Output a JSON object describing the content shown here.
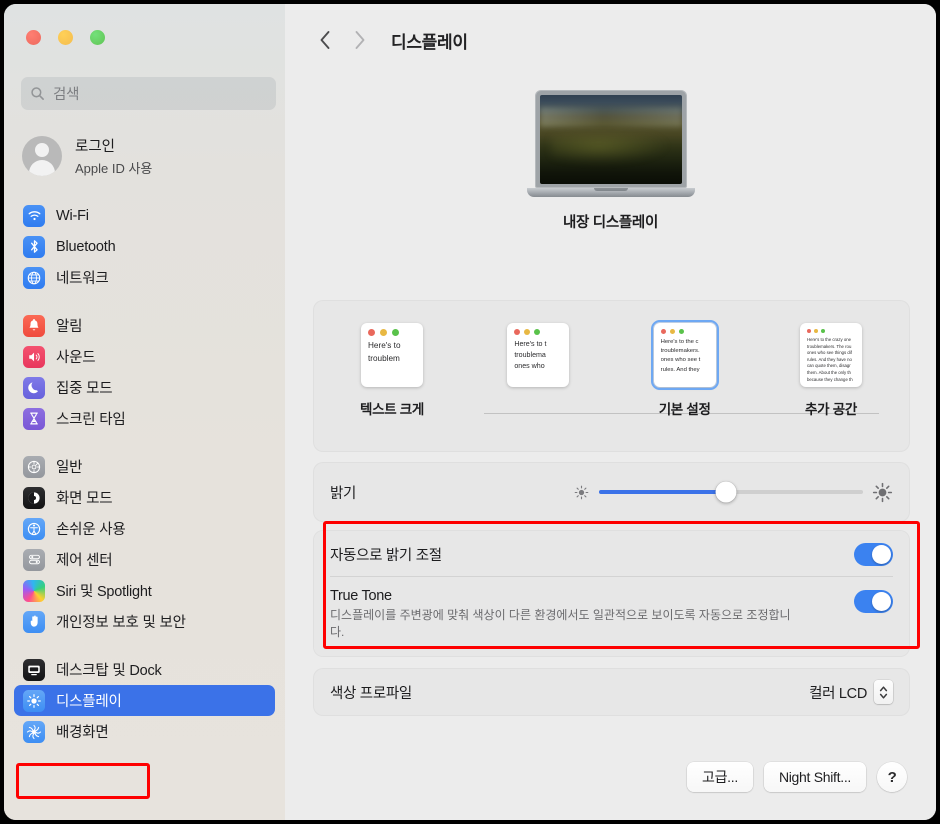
{
  "window": {
    "traffic_lights": [
      {
        "name": "close",
        "color": "#ed6a5e"
      },
      {
        "name": "minimize",
        "color": "#f4bd4f"
      },
      {
        "name": "zoom",
        "color": "#61c554"
      }
    ]
  },
  "sidebar": {
    "search": {
      "placeholder": "검색",
      "icon": "search-icon"
    },
    "account": {
      "name": "로그인",
      "subtitle": "Apple ID 사용",
      "avatar": "person-avatar"
    },
    "groups": [
      {
        "items": [
          {
            "label": "Wi-Fi",
            "icon": "wifi-icon",
            "color": "#2f7cf0",
            "selected": false
          },
          {
            "label": "Bluetooth",
            "icon": "bluetooth-icon",
            "color": "#2f7cf0",
            "selected": false
          },
          {
            "label": "네트워크",
            "icon": "globe-icon",
            "color": "#2f7cf0",
            "selected": false
          }
        ]
      },
      {
        "items": [
          {
            "label": "알림",
            "icon": "bell-icon",
            "color": "#ef4a3d",
            "selected": false
          },
          {
            "label": "사운드",
            "icon": "speaker-icon",
            "color": "#e8365c",
            "selected": false
          },
          {
            "label": "집중 모드",
            "icon": "moon-icon",
            "color": "#6761dc",
            "selected": false
          },
          {
            "label": "스크린 타임",
            "icon": "hourglass-icon",
            "color": "#7a57d6",
            "selected": false
          }
        ]
      },
      {
        "items": [
          {
            "label": "일반",
            "icon": "gear-icon",
            "color": "#94979d",
            "selected": false
          },
          {
            "label": "화면 모드",
            "icon": "appearance-icon",
            "color": "#131314",
            "selected": false
          },
          {
            "label": "손쉬운 사용",
            "icon": "accessibility-icon",
            "color": "#3d8ef3",
            "selected": false
          },
          {
            "label": "제어 센터",
            "icon": "control-center-icon",
            "color": "#94979d",
            "selected": false
          },
          {
            "label": "Siri 및 Spotlight",
            "icon": "siri-icon",
            "color": "#9b5cf6",
            "selected": false
          },
          {
            "label": "개인정보 보호 및 보안",
            "icon": "privacy-hand-icon",
            "color": "#3d8ef3",
            "selected": false
          }
        ]
      },
      {
        "items": [
          {
            "label": "데스크탑 및 Dock",
            "icon": "desktop-dock-icon",
            "color": "#131314",
            "selected": false
          },
          {
            "label": "디스플레이",
            "icon": "display-brightness-icon",
            "color": "#3d8ef3",
            "selected": true
          },
          {
            "label": "배경화면",
            "icon": "wallpaper-icon",
            "color": "#3d8ef3",
            "selected": false
          }
        ]
      }
    ]
  },
  "toolbar": {
    "back_icon": "chevron-left-icon",
    "forward_icon": "chevron-right-icon",
    "title": "디스플레이"
  },
  "hero": {
    "label": "내장 디스플레이",
    "device_icon": "macbook-icon"
  },
  "resolution": {
    "options": [
      {
        "label": "텍스트 크게",
        "selected": false,
        "scale": 1.0,
        "lines": [
          "Here's to",
          "troublem"
        ]
      },
      {
        "label": "",
        "selected": false,
        "scale": 0.86,
        "lines": [
          "Here's to t",
          "troublema",
          "ones who"
        ]
      },
      {
        "label": "기본 설정",
        "selected": true,
        "scale": 0.72,
        "lines": [
          "Here's to the c",
          "troublemakers.",
          "ones who see t",
          "rules. And they"
        ]
      },
      {
        "label": "추가 공간",
        "selected": false,
        "scale": 0.52,
        "lines": [
          "Here's to the crazy one",
          "troublemakers. The rou",
          "ones who see things dif",
          "rules. And they have no",
          "can quote them, disagr",
          "them. About the only th",
          "because they change th"
        ]
      }
    ]
  },
  "brightness": {
    "label": "밝기",
    "value_percent": 48,
    "min_icon": "sun-small-icon",
    "max_icon": "sun-large-icon"
  },
  "auto_brightness": {
    "label": "자동으로 밝기 조절",
    "toggle_on": true
  },
  "true_tone": {
    "label": "True Tone",
    "description": "디스플레이를 주변광에 맞춰 색상이 다른 환경에서도 일관적으로 보이도록 자동으로 조정합니다.",
    "toggle_on": true
  },
  "color_profile": {
    "label": "색상 프로파일",
    "value": "컬러 LCD",
    "stepper_icon": "chevron-up-down-icon"
  },
  "footer": {
    "advanced_label": "고급...",
    "night_shift_label": "Night Shift...",
    "help_label": "?"
  },
  "annotations": {
    "accent_red": "#fe0000",
    "accent_blue": "#3b72e8"
  }
}
